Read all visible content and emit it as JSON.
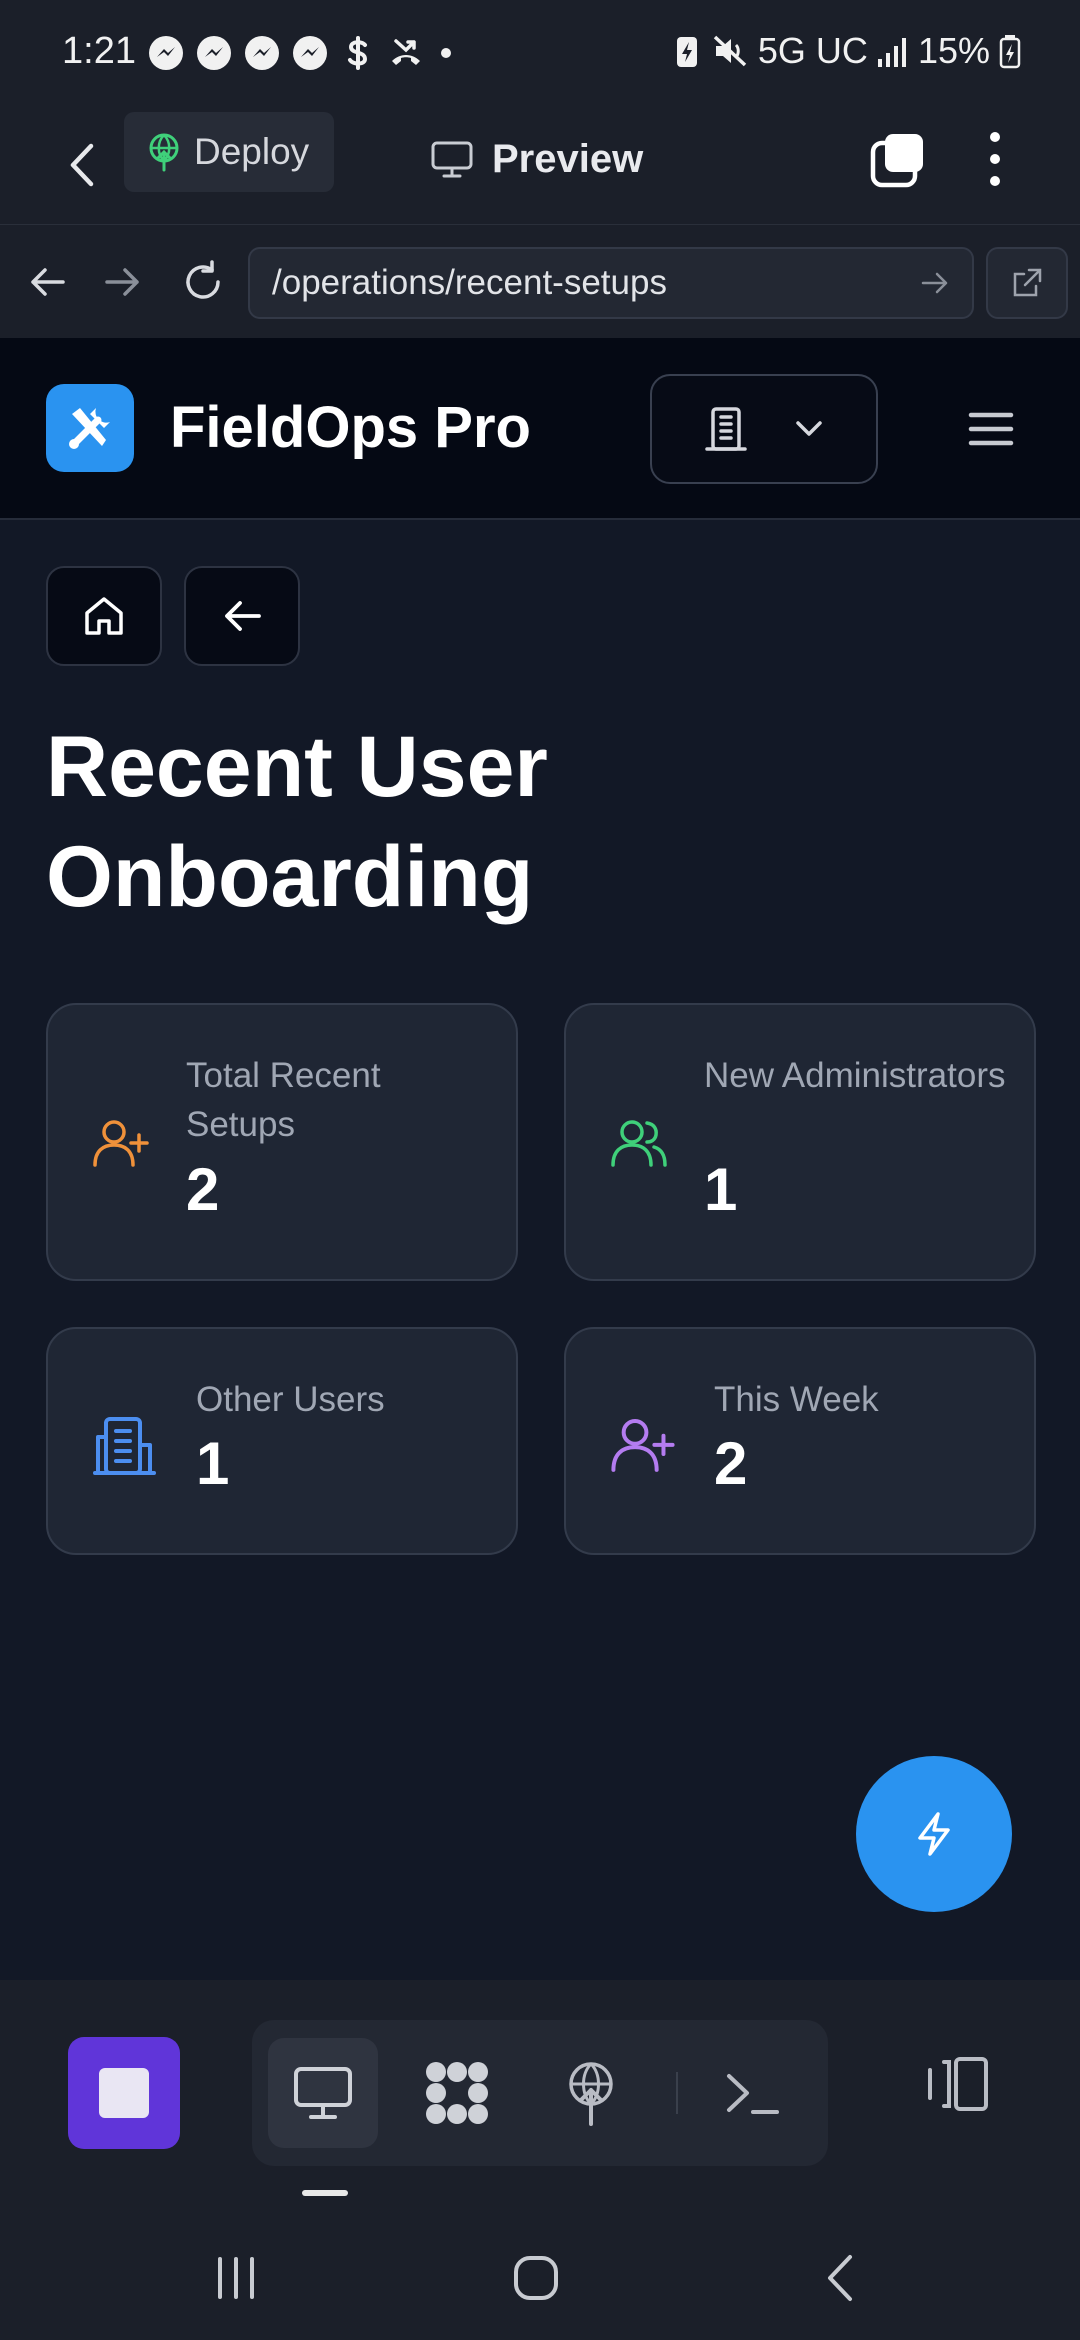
{
  "status_bar": {
    "time": "1:21",
    "network": "5G UC",
    "battery": "15%"
  },
  "app_toolbar": {
    "deploy_label": "Deploy",
    "preview_label": "Preview"
  },
  "browser": {
    "url": "/operations/recent-setups"
  },
  "site": {
    "brand": "FieldOps Pro",
    "accent_color": "#2a93f0"
  },
  "page": {
    "title": "Recent User Onboarding"
  },
  "stats": [
    {
      "label": "Total Recent Setups",
      "value": "2",
      "icon": "user-plus-icon",
      "color": "#f0913a"
    },
    {
      "label": "New Administrators",
      "value": "1",
      "icon": "users-icon",
      "color": "#3fd07a"
    },
    {
      "label": "Other Users",
      "value": "1",
      "icon": "building-icon",
      "color": "#4c8ef0"
    },
    {
      "label": "This Week",
      "value": "2",
      "icon": "user-plus-icon",
      "color": "#b47cf0"
    }
  ]
}
